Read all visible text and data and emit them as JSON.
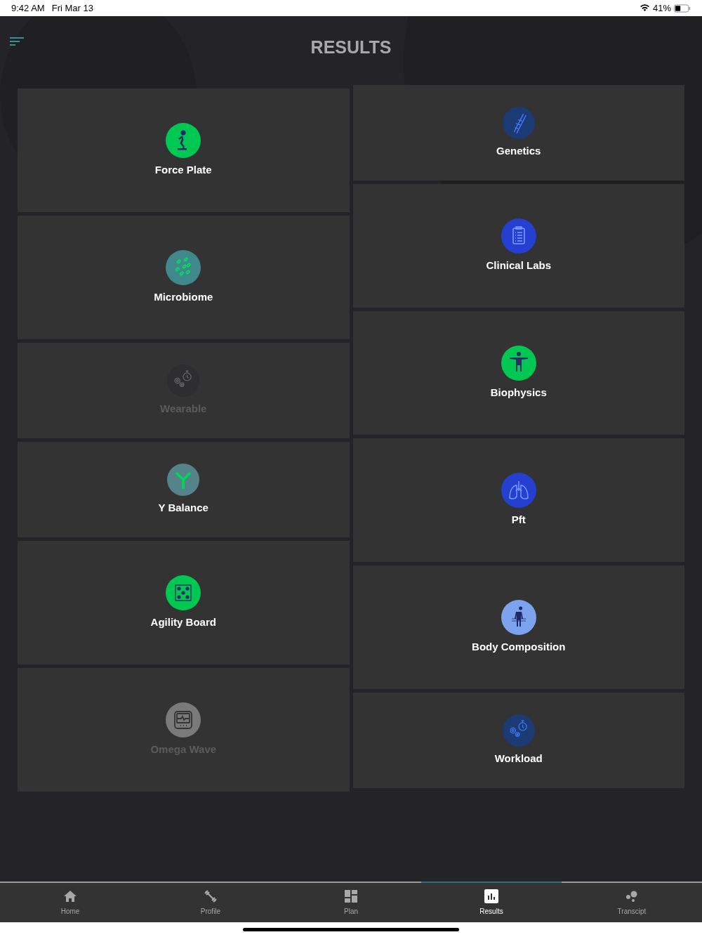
{
  "status_bar": {
    "time": "9:42 AM",
    "date": "Fri Mar 13",
    "battery": "41%"
  },
  "title": "RESULTS",
  "columns": [
    [
      {
        "label": "Force Plate",
        "kind": "tall",
        "disabled": false,
        "color": "#00c853"
      },
      {
        "label": "Microbiome",
        "kind": "tall",
        "disabled": false,
        "color": "#3f888c"
      },
      {
        "label": "Wearable",
        "kind": "short",
        "disabled": true,
        "color": "#2e2e30"
      },
      {
        "label": "Y Balance",
        "kind": "short",
        "disabled": false,
        "color": "#54838a"
      },
      {
        "label": "Agility Board",
        "kind": "tall",
        "disabled": false,
        "color": "#00c853"
      },
      {
        "label": "Omega Wave",
        "kind": "tall",
        "disabled": true,
        "color": "#7a7a7a"
      }
    ],
    [
      {
        "label": "Genetics",
        "kind": "short",
        "disabled": false,
        "color": "#1c3a74"
      },
      {
        "label": "Clinical Labs",
        "kind": "tall",
        "disabled": false,
        "color": "#2540d0"
      },
      {
        "label": "Biophysics",
        "kind": "tall",
        "disabled": false,
        "color": "#00c853"
      },
      {
        "label": "Pft",
        "kind": "tall",
        "disabled": false,
        "color": "#2540d0"
      },
      {
        "label": "Body Composition",
        "kind": "tall",
        "disabled": false,
        "color": "#7ea3ee"
      },
      {
        "label": "Workload",
        "kind": "short",
        "disabled": false,
        "color": "#1c3a74"
      }
    ]
  ],
  "tabs": [
    {
      "label": "Home",
      "selected": false
    },
    {
      "label": "Profile",
      "selected": false
    },
    {
      "label": "Plan",
      "selected": false
    },
    {
      "label": "Results",
      "selected": true
    },
    {
      "label": "Transcipt",
      "selected": false
    }
  ]
}
